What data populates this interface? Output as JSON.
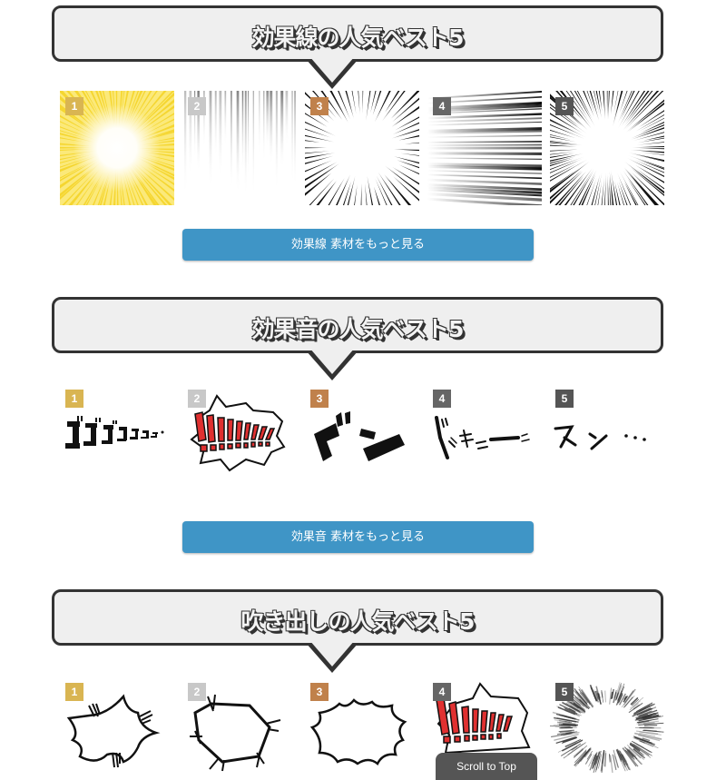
{
  "badge_colors": {
    "1": "#d9b552",
    "2": "#c8c8c8",
    "3": "#c0814b",
    "4": "#666666",
    "5": "#555555"
  },
  "sections": [
    {
      "title": "効果線の人気ベスト5",
      "items": [
        {
          "rank": "1",
          "name": "yellow-radial-burst"
        },
        {
          "rank": "2",
          "name": "vertical-speed-lines"
        },
        {
          "rank": "3",
          "name": "radial-focus-lines"
        },
        {
          "rank": "4",
          "name": "horizontal-speed-lines"
        },
        {
          "rank": "5",
          "name": "dense-radial-focus-lines"
        }
      ],
      "button_label": "効果線 素材をもっと見る"
    },
    {
      "title": "効果音の人気ベスト5",
      "items": [
        {
          "rank": "1",
          "name": "gogogo-sfx",
          "text": "ゴゴゴゴゴゴゴ"
        },
        {
          "rank": "2",
          "name": "exclamation-burst-sfx",
          "text": "!!!!!!!!"
        },
        {
          "rank": "3",
          "name": "don-sfx",
          "text": "ドン"
        },
        {
          "rank": "4",
          "name": "dokyun-sfx",
          "text": "ドッキューン"
        },
        {
          "rank": "5",
          "name": "sun-sfx",
          "text": "スン…"
        }
      ],
      "button_label": "効果音 素材をもっと見る"
    },
    {
      "title": "吹き出しの人気ベスト5",
      "items": [
        {
          "rank": "1",
          "name": "spiky-speech-bubble"
        },
        {
          "rank": "2",
          "name": "hexagon-speech-bubble"
        },
        {
          "rank": "3",
          "name": "cloud-burst-speech-bubble"
        },
        {
          "rank": "4",
          "name": "exclamation-burst-bubble"
        },
        {
          "rank": "5",
          "name": "fuzzy-burst-bubble"
        }
      ]
    }
  ],
  "scroll_to_top": "Scroll to Top"
}
